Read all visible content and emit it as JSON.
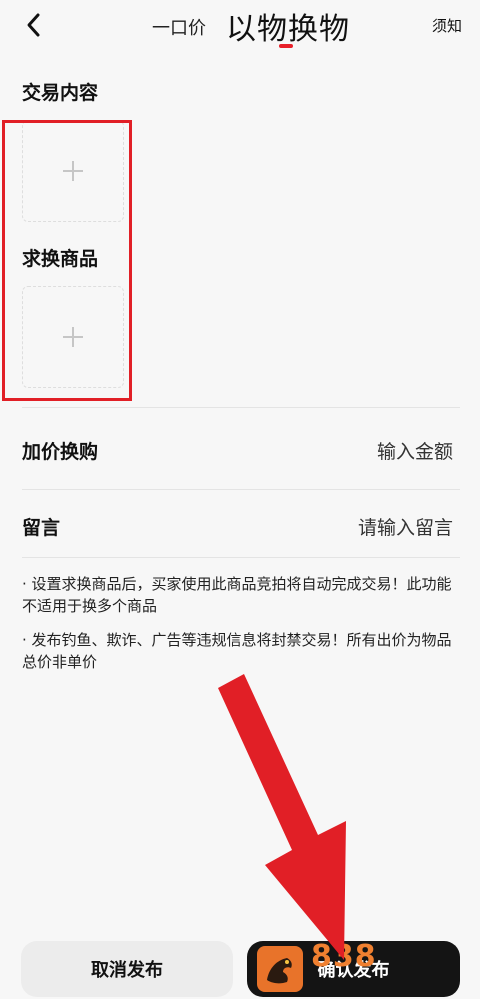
{
  "header": {
    "back_icon": "chevron-left-icon",
    "tabs": [
      {
        "label": "一口价",
        "active": false
      },
      {
        "label": "以物换物",
        "active": true
      }
    ],
    "notice_label": "须知",
    "accent_color": "#e8202a"
  },
  "trade_content": {
    "title": "交易内容",
    "upload_icon": "plus-icon"
  },
  "wanted_goods": {
    "title": "求换商品",
    "upload_icon": "plus-icon"
  },
  "add_price": {
    "label": "加价换购",
    "placeholder": "输入金额"
  },
  "message": {
    "label": "留言",
    "placeholder": "请输入留言"
  },
  "notes": [
    "· 设置求换商品后，买家使用此商品竞拍将自动完成交易！此功能不适用于换多个商品",
    "· 发布钓鱼、欺诈、广告等违规信息将封禁交易！所有出价为物品总价非单价"
  ],
  "footer": {
    "cancel_label": "取消发布",
    "confirm_label": "确认发布"
  },
  "watermark": {
    "text": "838"
  },
  "annotation": {
    "highlight_color": "#e11f26",
    "arrow_color": "#e11f26"
  }
}
